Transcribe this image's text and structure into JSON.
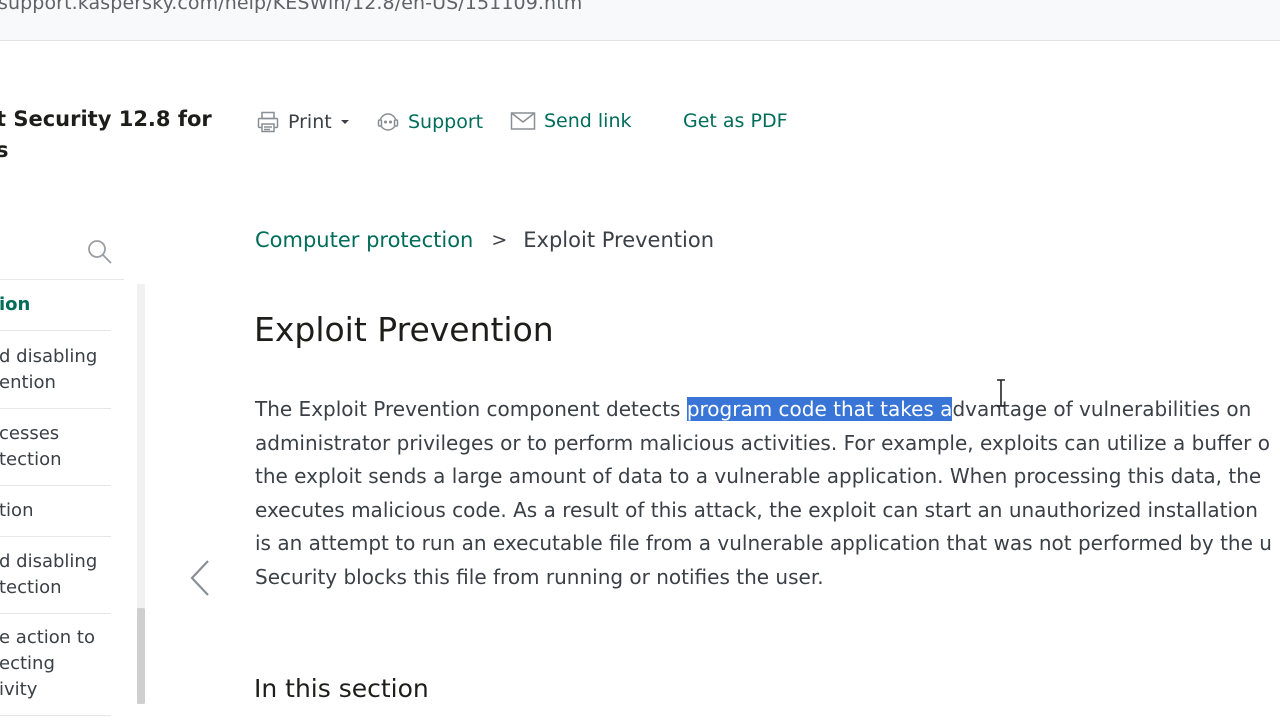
{
  "browser": {
    "url": "support.kaspersky.com/help/KESWin/12.8/en-US/151109.htm"
  },
  "header": {
    "product_title_line1": "t Security 12.8 for",
    "product_title_line2": "s"
  },
  "toolbar": {
    "print_label": "Print",
    "support_label": "Support",
    "send_link_label": "Send link",
    "pdf_label": "Get as PDF"
  },
  "sidebar": {
    "items": [
      {
        "lines": [
          "ion"
        ],
        "active": true
      },
      {
        "lines": [
          "d disabling",
          "ention"
        ]
      },
      {
        "lines": [
          "cesses",
          "tection"
        ]
      },
      {
        "lines": [
          "tion"
        ]
      },
      {
        "lines": [
          "d disabling",
          "tection"
        ]
      },
      {
        "lines": [
          "e action to",
          "ecting",
          "ivity"
        ]
      }
    ]
  },
  "breadcrumb": {
    "parent": "Computer protection",
    "separator": ">",
    "current": "Exploit Prevention"
  },
  "article": {
    "title": "Exploit Prevention",
    "para": {
      "l1_pre": "The Exploit Prevention component detects ",
      "l1_sel": "program code that takes a",
      "l1_post": "dvantage of vulnerabilities on",
      "l2": "administrator privileges or to perform malicious activities. For example, exploits can utilize a buffer o",
      "l3": "the exploit sends a large amount of data to a vulnerable application. When processing this data, the",
      "l4": "executes malicious code. As a result of this attack, the exploit can start an unauthorized installation",
      "l5": "is an attempt to run an executable file from a vulnerable application that was not performed by the u",
      "l6": "Security blocks this file from running or notifies the user."
    },
    "section_title": "In this section"
  },
  "colors": {
    "accent_green": "#006d5b",
    "selection_blue": "#3875d7",
    "text_dark": "#1d1d1b",
    "text_body": "#3a4046"
  },
  "icons": [
    "printer-icon",
    "caret-down-icon",
    "support-headset-icon",
    "mail-icon",
    "search-icon",
    "chevron-left-icon",
    "text-cursor-icon"
  ]
}
